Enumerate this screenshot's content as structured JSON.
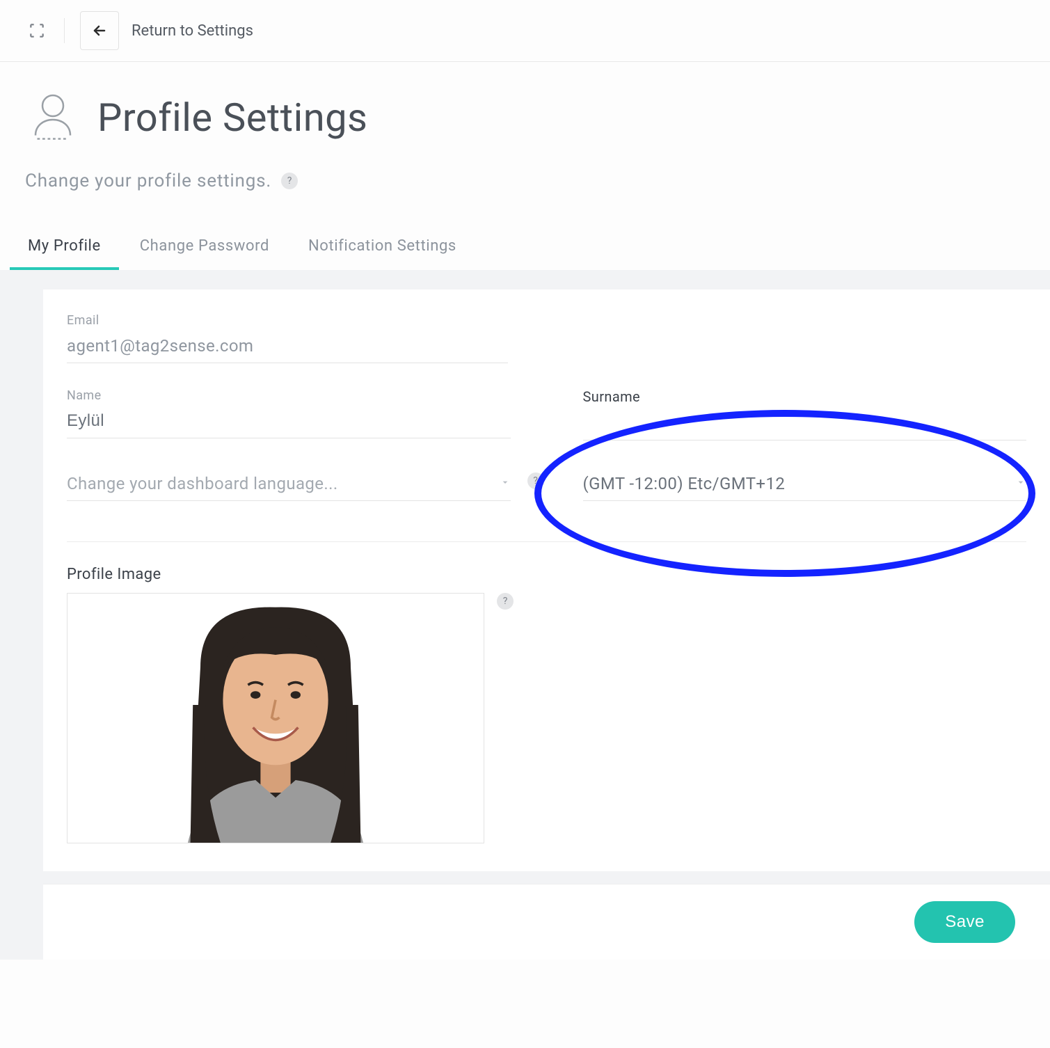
{
  "topbar": {
    "return_label": "Return to Settings"
  },
  "header": {
    "title": "Profile Settings",
    "subtitle": "Change your profile settings.",
    "help_char": "?"
  },
  "tabs": [
    {
      "label": "My Profile",
      "active": true
    },
    {
      "label": "Change Password",
      "active": false
    },
    {
      "label": "Notification Settings",
      "active": false
    }
  ],
  "form": {
    "email_label": "Email",
    "email_value": "agent1@tag2sense.com",
    "name_label": "Name",
    "name_value": "Eylül",
    "surname_label": "Surname",
    "surname_value": "",
    "language_placeholder": "Change your dashboard language...",
    "timezone_value": "(GMT -12:00) Etc/GMT+12",
    "profile_image_label": "Profile Image"
  },
  "footer": {
    "save_label": "Save"
  },
  "icons": {
    "help": "?"
  },
  "annotation": {
    "ellipse_note": "blue highlight circle around timezone dropdown"
  }
}
